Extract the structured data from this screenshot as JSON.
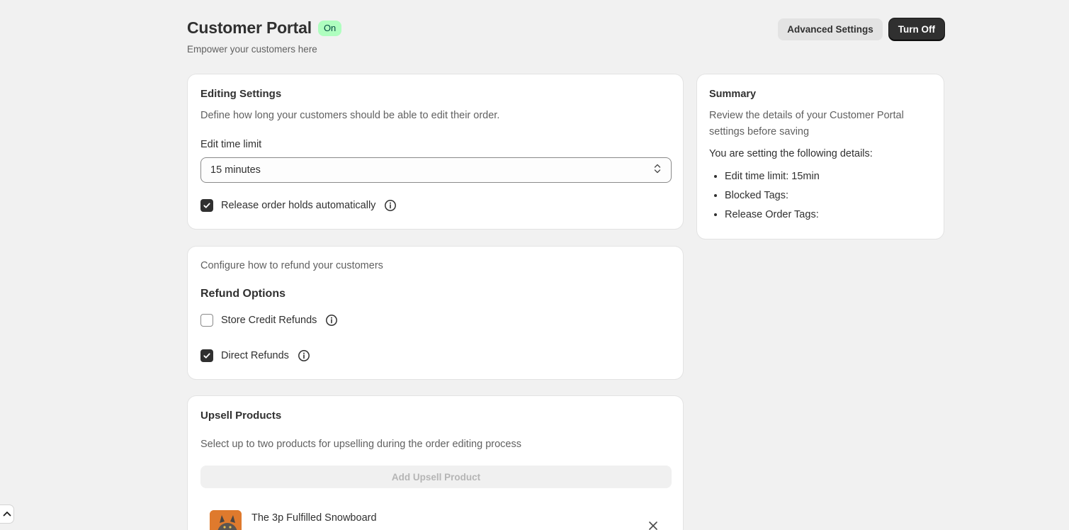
{
  "header": {
    "title": "Customer Portal",
    "status_badge": "On",
    "subtitle": "Empower your customers here",
    "advanced_settings_label": "Advanced Settings",
    "turn_off_label": "Turn Off"
  },
  "editing": {
    "title": "Editing Settings",
    "description": "Define how long your customers should be able to edit their order.",
    "time_limit_label": "Edit time limit",
    "time_limit_value": "15 minutes",
    "release_holds_label": "Release order holds automatically",
    "release_holds_checked": true
  },
  "refund": {
    "description": "Configure how to refund your customers",
    "title": "Refund Options",
    "store_credit_label": "Store Credit Refunds",
    "store_credit_checked": false,
    "direct_label": "Direct Refunds",
    "direct_checked": true
  },
  "upsell": {
    "title": "Upsell Products",
    "description": "Select up to two products for upselling during the order editing process",
    "add_label": "Add Upsell Product",
    "products": [
      {
        "name": "The 3p Fulfilled Snowboard"
      }
    ]
  },
  "summary": {
    "title": "Summary",
    "description": "Review the details of your Customer Portal settings before saving",
    "intro": "You are setting the following details:",
    "items": [
      "Edit time limit: 15min",
      "Blocked Tags:",
      "Release Order Tags:"
    ]
  },
  "colors": {
    "badge_bg": "#affebf",
    "primary": "#303030",
    "page_bg": "#f1f1f1"
  },
  "icons": {
    "info": "info-icon",
    "select_chevron": "chevron-up-down-icon",
    "remove": "close-icon",
    "scroll_top": "chevron-up-icon"
  }
}
